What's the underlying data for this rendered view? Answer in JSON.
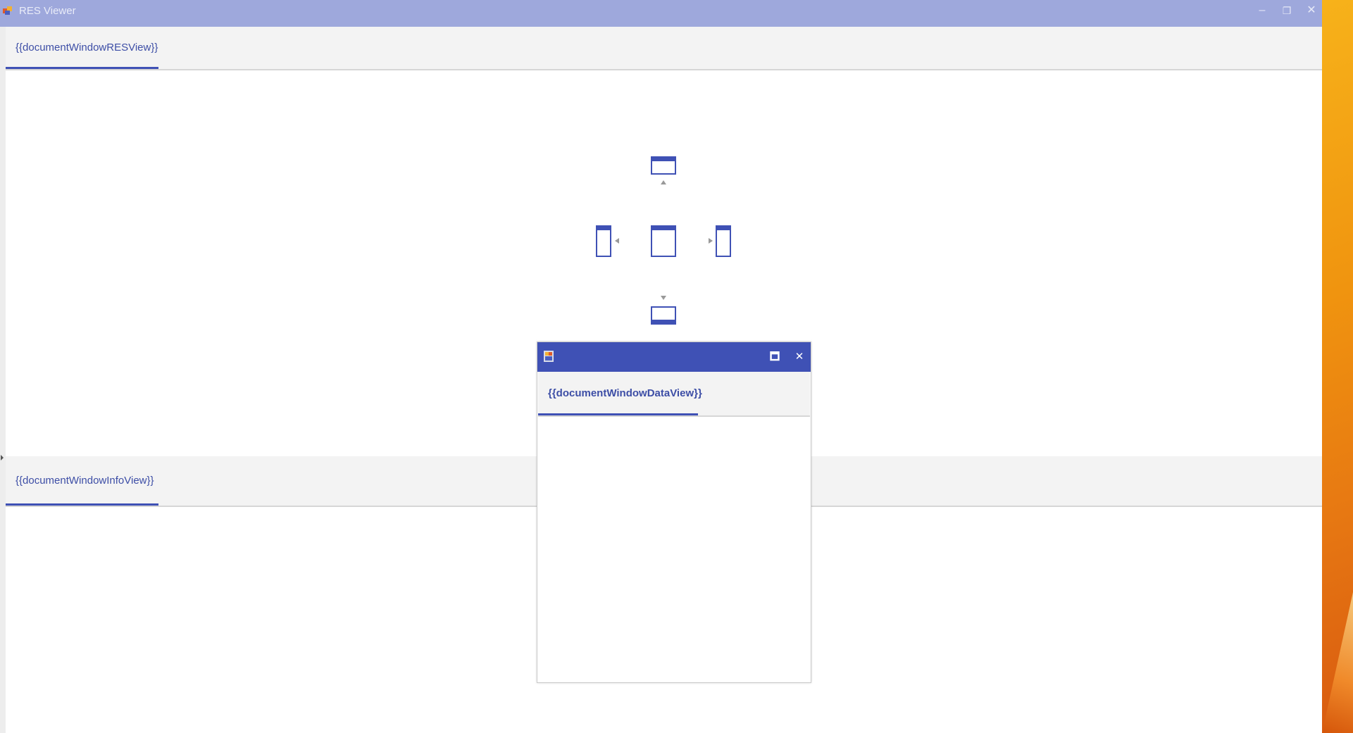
{
  "app": {
    "title": "RES Viewer",
    "controls": {
      "minimize": "–",
      "restore": "❐",
      "close": "✕"
    }
  },
  "top_pane": {
    "tabs": [
      {
        "label": "{{documentWindowRESView}}",
        "active": true
      }
    ]
  },
  "bottom_pane": {
    "tabs": [
      {
        "label": "{{documentWindowInfoView}}",
        "active": true
      }
    ]
  },
  "floating_window": {
    "controls": {
      "maximize": "🗖",
      "close": "✕"
    },
    "tabs": [
      {
        "label": "{{documentWindowDataView}}",
        "active": true
      }
    ]
  },
  "dock_guide": {
    "targets": [
      "dock-top",
      "dock-left",
      "dock-center",
      "dock-right",
      "dock-bottom"
    ]
  },
  "colors": {
    "accent": "#3f51b5",
    "titlebar_inactive": "#9ea8dc",
    "tab_strip": "#f3f3f3"
  }
}
